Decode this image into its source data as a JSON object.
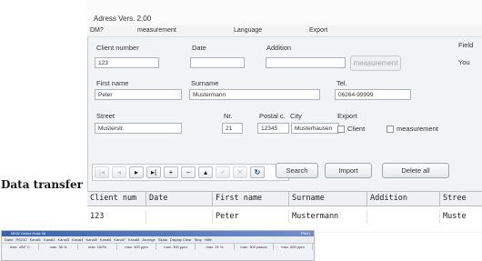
{
  "window": {
    "title": "Adress Vers. 2.00"
  },
  "menu": [
    "DM?",
    "measurement",
    "Language",
    "Export"
  ],
  "form": {
    "client_number": {
      "label": "Client number",
      "value": "123"
    },
    "date": {
      "label": "Date",
      "value": ""
    },
    "addition": {
      "label": "Addition",
      "value": ""
    },
    "measurement_button": "measurement",
    "first_name": {
      "label": "First name",
      "value": "Peter"
    },
    "surname": {
      "label": "Surname",
      "value": "Mustermann"
    },
    "tel": {
      "label": "Tel.",
      "value": "06264-99999"
    },
    "street": {
      "label": "Street",
      "value": "Musterstr."
    },
    "nr": {
      "label": "Nr.",
      "value": "21"
    },
    "postal": {
      "label": "Postal c.",
      "value": "12345"
    },
    "city": {
      "label": "City",
      "value": "Musterhausen"
    },
    "export": {
      "label": "Export",
      "client": "Client",
      "measurement": "measurement"
    },
    "right_edge": {
      "line1": "Field",
      "line2": "You"
    }
  },
  "navigator": [
    {
      "name": "first-record",
      "glyph": "|◂",
      "enabled": false
    },
    {
      "name": "prev-record",
      "glyph": "◂",
      "enabled": false
    },
    {
      "name": "next-record",
      "glyph": "▸",
      "enabled": true
    },
    {
      "name": "last-record",
      "glyph": "▸|",
      "enabled": true
    },
    {
      "name": "insert-record",
      "glyph": "+",
      "enabled": true
    },
    {
      "name": "delete-record",
      "glyph": "−",
      "enabled": true
    },
    {
      "name": "edit-record",
      "glyph": "▴",
      "enabled": true
    },
    {
      "name": "post-record",
      "glyph": "✓",
      "enabled": false
    },
    {
      "name": "cancel-record",
      "glyph": "✕",
      "enabled": false
    },
    {
      "name": "refresh-record",
      "glyph": "↻",
      "enabled": true
    }
  ],
  "buttons": {
    "search": "Search",
    "import": "Import",
    "delete_all": "Delete all"
  },
  "caption": "Data transfer",
  "grid": {
    "columns": [
      "Client num",
      "Date",
      "First name",
      "Surname",
      "Addition",
      "Stree"
    ],
    "row": [
      "123",
      "",
      "Peter",
      "Mustermann",
      "",
      "Muste"
    ]
  },
  "thumbnail": {
    "title": "MKW Online Hose NI",
    "title_right": "Pfeil I",
    "menu": [
      "Datei",
      "RS232",
      "Kanal1",
      "Kanal2",
      "Kanal3",
      "Kanal4",
      "Kanal5",
      "Kanal6",
      "Kanal7",
      "Kanal8",
      "Anzeige",
      "Skala",
      "Display Clear",
      "Stop",
      "Hilfe"
    ],
    "row": [
      "max. 498° C",
      "max. 38 %",
      "max. 100%",
      "max. 300 ppm",
      "max. 300 ppm",
      "max. 21 %",
      "max. 300 pascal",
      "max. 600 ppm"
    ]
  }
}
